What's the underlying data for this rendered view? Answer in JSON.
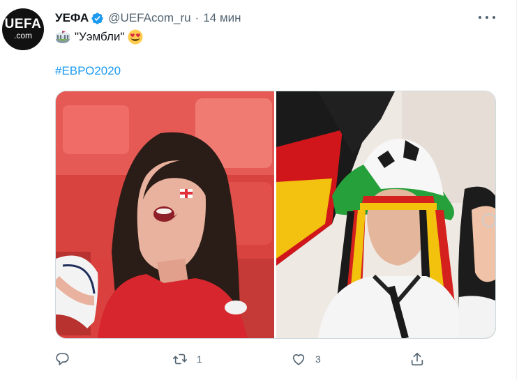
{
  "account": {
    "avatar_title": "UEFA",
    "avatar_subtitle": ".com",
    "name": "УЕФА",
    "handle": "@UEFAcom_ru",
    "separator": "·",
    "time": "14 мин"
  },
  "tweet": {
    "text": "\"Уэмбли\"",
    "hashtag": "#ЕВРО2020"
  },
  "media": {
    "photos": [
      {
        "subject": "england-fan-photo"
      },
      {
        "subject": "germany-fan-photo"
      }
    ]
  },
  "actions": {
    "reply_count": "",
    "retweet_count": "1",
    "like_count": "3"
  },
  "colors": {
    "accent": "#1d9bf0",
    "text_secondary": "#536471",
    "border": "#cfd9de"
  },
  "icons": [
    "verified-badge-icon",
    "stadium-emoji-icon",
    "heart-eyes-emoji-icon",
    "more-icon",
    "reply-icon",
    "retweet-icon",
    "like-icon",
    "share-icon"
  ]
}
